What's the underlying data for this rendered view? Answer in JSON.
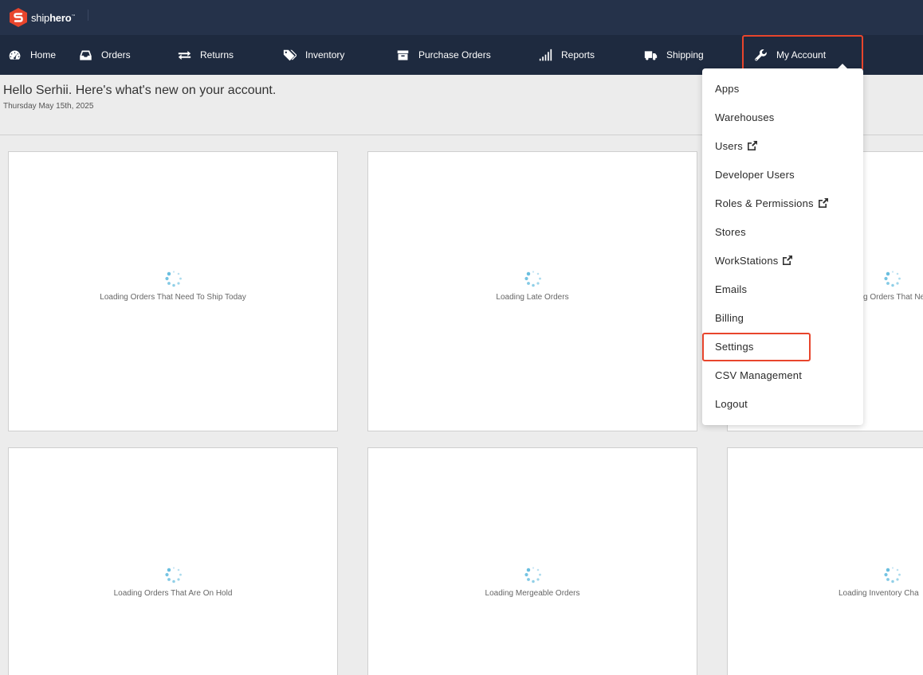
{
  "brand": {
    "name_light": "ship",
    "name_bold": "hero",
    "tm": "™",
    "accent": "#e8452c"
  },
  "nav": {
    "items": [
      {
        "label": "Home",
        "icon": "dashboard-icon",
        "has_caret": false
      },
      {
        "label": "Orders",
        "icon": "inbox-icon",
        "has_caret": true
      },
      {
        "label": "Returns",
        "icon": "exchange-icon",
        "has_caret": true
      },
      {
        "label": "Inventory",
        "icon": "tags-icon",
        "has_caret": true
      },
      {
        "label": "Purchase Orders",
        "icon": "archive-icon",
        "has_caret": true
      },
      {
        "label": "Reports",
        "icon": "signal-bars-icon",
        "has_caret": true
      },
      {
        "label": "Shipping",
        "icon": "truck-icon",
        "has_caret": true
      },
      {
        "label": "My Account",
        "icon": "wrench-icon",
        "has_caret": true
      }
    ]
  },
  "account_menu": {
    "items": [
      {
        "label": "Apps",
        "external": false
      },
      {
        "label": "Warehouses",
        "external": false
      },
      {
        "label": "Users",
        "external": true
      },
      {
        "label": "Developer Users",
        "external": false
      },
      {
        "label": "Roles & Permissions",
        "external": true
      },
      {
        "label": "Stores",
        "external": false
      },
      {
        "label": "WorkStations",
        "external": true
      },
      {
        "label": "Emails",
        "external": false
      },
      {
        "label": "Billing",
        "external": false
      },
      {
        "label": "Settings",
        "external": false
      },
      {
        "label": "CSV Management",
        "external": false
      },
      {
        "label": "Logout",
        "external": false
      }
    ]
  },
  "header": {
    "greeting": "Hello Serhii. Here's what's new on your account.",
    "date": "Thursday May 15th, 2025"
  },
  "cards": [
    {
      "label": "Loading Orders That Need To Ship Today"
    },
    {
      "label": "Loading Late Orders"
    },
    {
      "label": "Loading Orders That Need"
    },
    {
      "label": "Loading Orders That Are On Hold"
    },
    {
      "label": "Loading Mergeable Orders"
    },
    {
      "label": "Loading Inventory Cha"
    }
  ],
  "colors": {
    "topbar": "#25324a",
    "navbar": "#1e2a3f",
    "spinner": "#5bb8dc",
    "highlight": "#e8452c"
  }
}
